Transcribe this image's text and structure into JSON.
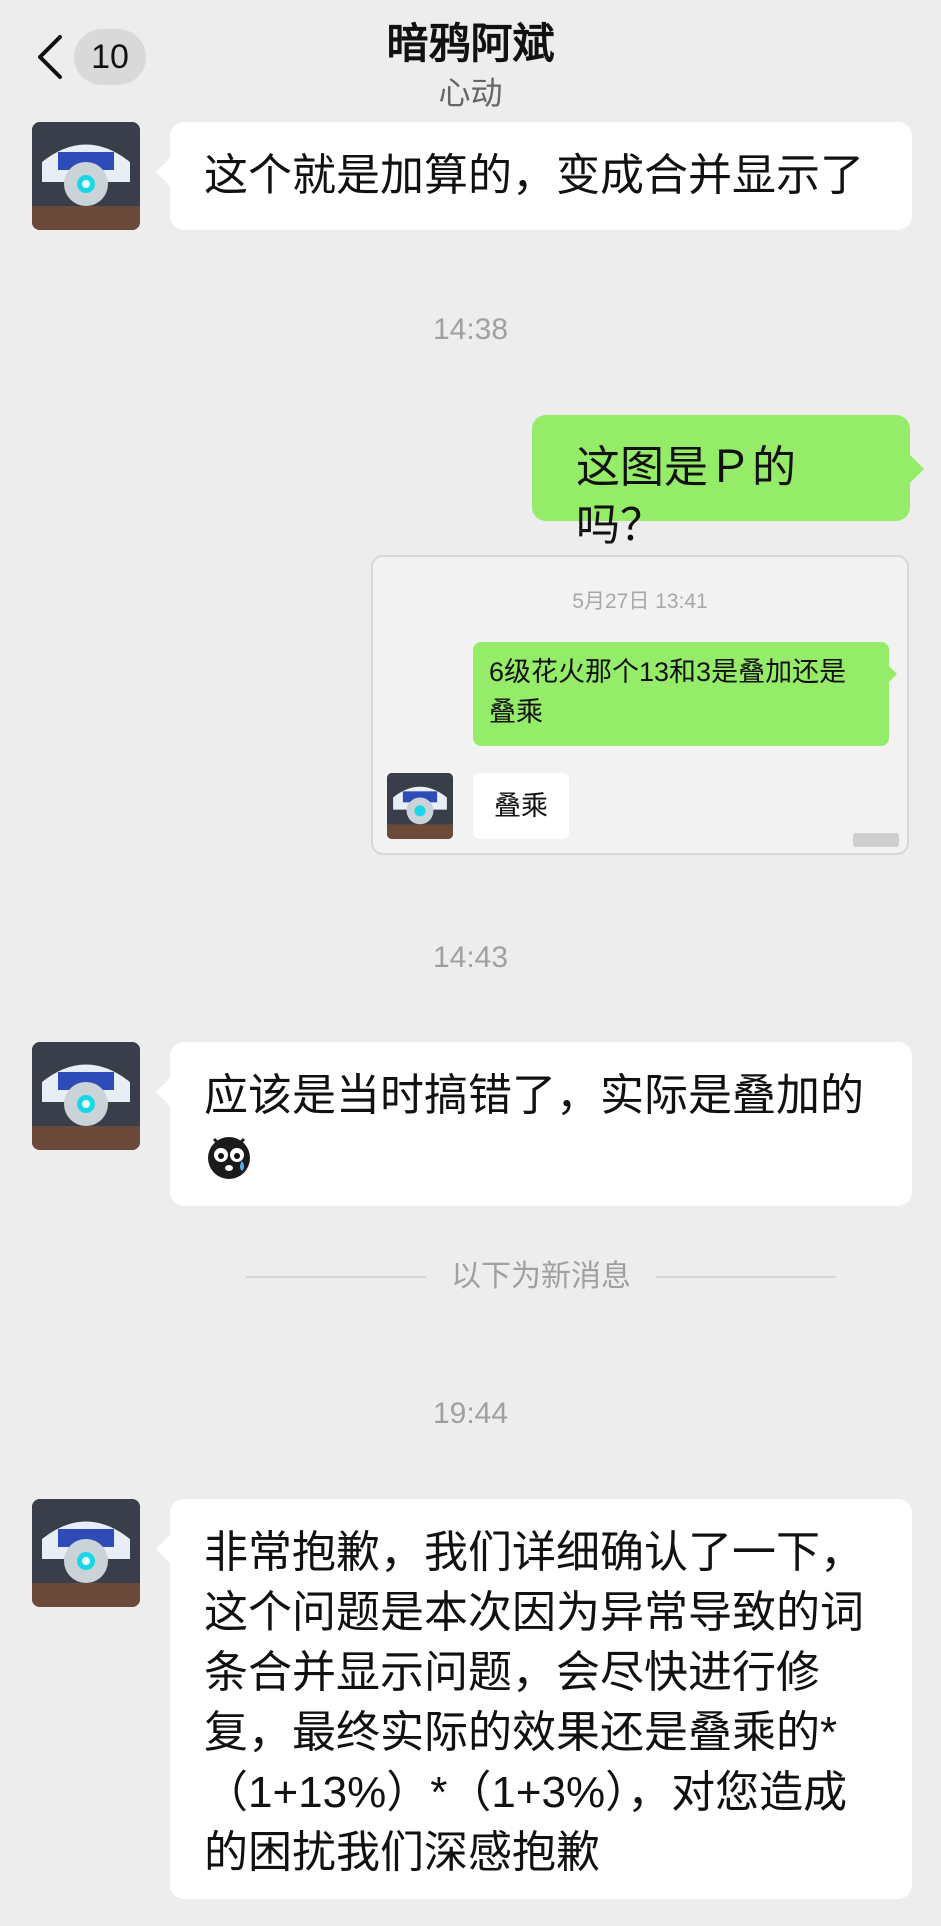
{
  "header": {
    "unread_count": "10",
    "title": "暗鸦阿斌",
    "subtitle": "心动"
  },
  "messages": {
    "m1": "这个就是加算的，变成合并显示了",
    "ts1": "14:38",
    "m2": "这图是Ｐ的吗？",
    "forward": {
      "timestamp": "5月27日 13:41",
      "green": "6级花火那个13和3是叠加还是叠乘",
      "white": "叠乘"
    },
    "ts2": "14:43",
    "m3": "应该是当时搞错了，实际是叠加的",
    "m3_emoji": "crying-face-icon",
    "divider": "以下为新消息",
    "ts3": "19:44",
    "m4": "非常抱歉，我们详细确认了一下，这个问题是本次因为异常导致的词条合并显示问题，会尽快进行修复，最终实际的效果还是叠乘的*（1+13%）*（1+3%），对您造成的困扰我们深感抱歉"
  },
  "colors": {
    "background": "#ededed",
    "self_bubble": "#95ec69",
    "other_bubble": "#ffffff"
  }
}
